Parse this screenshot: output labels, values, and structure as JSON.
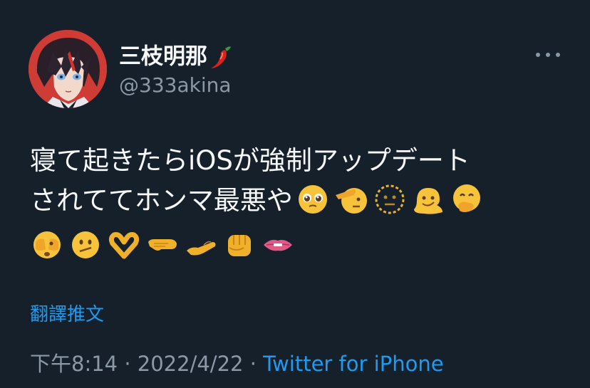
{
  "tweet": {
    "author": {
      "display_name": "三枝明那",
      "name_emoji": "hot-pepper-emoji",
      "handle": "@333akina"
    },
    "more_icon": "more-horizontal-icon",
    "text_lines": [
      "寝て起きたらiOSが強制アップデート",
      "されててホンマ最悪や"
    ],
    "line2_emojis": [
      "pleading-face-emoji",
      "saluting-face-emoji",
      "dotted-line-face-emoji",
      "melting-face-emoji",
      "hand-over-mouth-emoji"
    ],
    "line3_emojis": [
      "face-with-peeking-eye-emoji",
      "face-with-diagonal-mouth-emoji",
      "heart-hands-emoji",
      "leftwards-hand-emoji",
      "palm-up-hand-emoji",
      "oncoming-fist-emoji",
      "biting-lip-emoji"
    ],
    "translate_label": "翻譯推文",
    "time": "下午8:14",
    "separator": "·",
    "date": "2022/4/22",
    "source": "Twitter for iPhone"
  },
  "colors": {
    "background": "#15202b",
    "text_primary": "#f7f9f9",
    "text_secondary": "#8b98a5",
    "accent": "#1d9bf0"
  }
}
